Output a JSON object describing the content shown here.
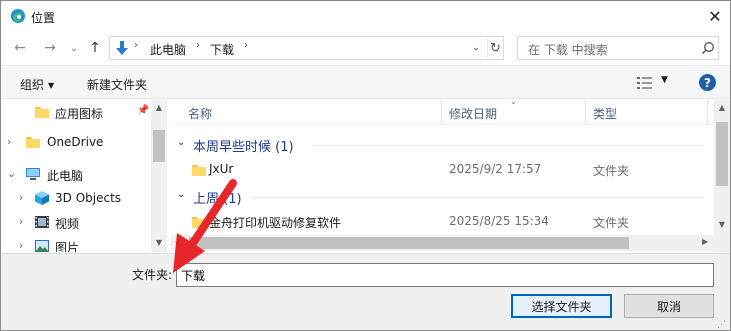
{
  "window": {
    "title": "位置",
    "close_glyph": "✕"
  },
  "nav": {
    "back": "←",
    "forward": "→",
    "recent": "⌄",
    "up": "↑",
    "breadcrumbs": [
      "此电脑",
      "下载"
    ],
    "separator": "›",
    "refresh": "↻",
    "dropdown": "⌄",
    "search_placeholder": "在 下载 中搜索"
  },
  "toolbar": {
    "organize": "组织",
    "new_folder": "新建文件夹",
    "help": "?"
  },
  "navpane": {
    "items": [
      {
        "label": "应用图标",
        "icon": "folder-icon",
        "pinned": true,
        "expander": ""
      },
      {
        "label": "OneDrive",
        "icon": "folder-icon",
        "pinned": false,
        "expander": "›"
      },
      {
        "label": "此电脑",
        "icon": "computer-icon",
        "pinned": false,
        "expander": "⌄"
      },
      {
        "label": "3D Objects",
        "icon": "cube-icon",
        "pinned": false,
        "expander": "›"
      },
      {
        "label": "视频",
        "icon": "video-icon",
        "pinned": false,
        "expander": "›"
      },
      {
        "label": "图片",
        "icon": "picture-icon",
        "pinned": false,
        "expander": "›"
      }
    ]
  },
  "content": {
    "columns": [
      "名称",
      "修改日期",
      "类型"
    ],
    "groups": [
      {
        "label": "本周早些时候 (1)",
        "files": [
          {
            "name": "JxUr",
            "modified": "2025/9/2 17:57",
            "type": "文件夹"
          }
        ]
      },
      {
        "label": "上周 (1)",
        "files": [
          {
            "name": "金舟打印机驱动修复软件",
            "modified": "2025/8/25 15:34",
            "type": "文件夹"
          }
        ]
      }
    ]
  },
  "bottom": {
    "folder_label": "文件夹:",
    "folder_value": "下载",
    "select_button": "选择文件夹",
    "cancel_button": "取消"
  },
  "colors": {
    "accent": "#0067c0",
    "folder": "#f4c542",
    "arrow": "#e8262a",
    "group_text": "#1e3a8a"
  }
}
